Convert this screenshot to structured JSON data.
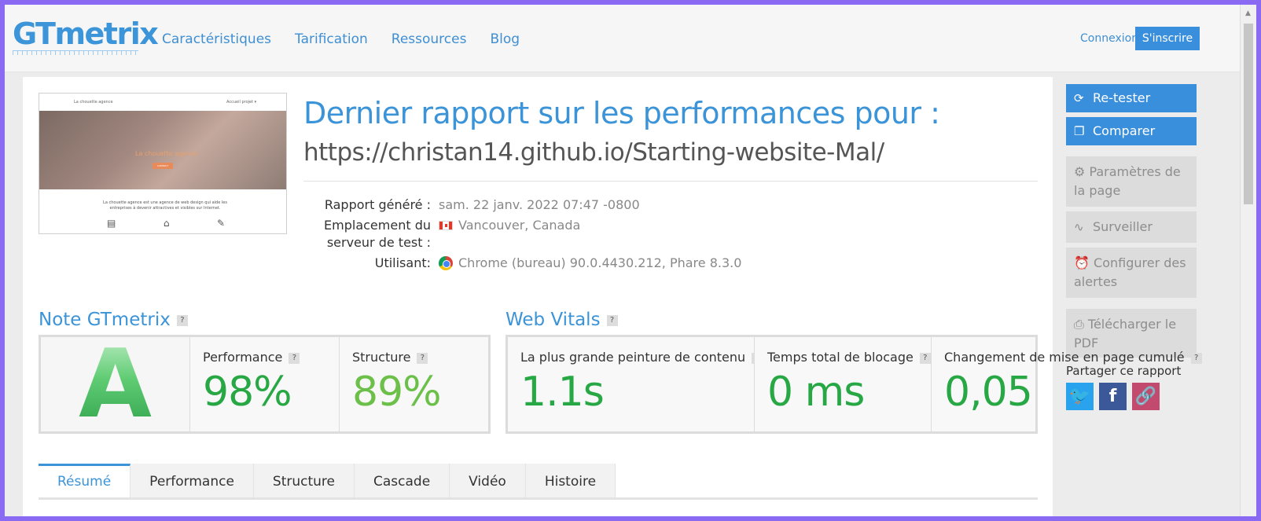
{
  "header": {
    "logo": "GTmetrix",
    "nav": [
      "Caractéristiques",
      "Tarification",
      "Ressources",
      "Blog"
    ],
    "login": "Connexion",
    "signup": "S'inscrire"
  },
  "report": {
    "title": "Dernier rapport sur les performances pour :",
    "url": "https://christan14.github.io/Starting-website-Mal/",
    "meta": [
      {
        "label": "Rapport généré :",
        "value": "sam. 22 janv. 2022 07:47 -0800"
      },
      {
        "label": "Emplacement du serveur de test :",
        "value": "Vancouver, Canada"
      },
      {
        "label": "Utilisant:",
        "value": "Chrome (bureau) 90.0.4430.212, Phare 8.3.0"
      }
    ]
  },
  "thumbnail": {
    "site_name": "La chouette agence",
    "nav_right": "Accueil  projet ▾",
    "hero_text": "La chouette agence",
    "hero_button": "CONTACT",
    "body_text": "La chouette agence est une agence de web design qui aide les entreprises à devenir attractives et visibles sur Internet."
  },
  "grade": {
    "section_title": "Note GTmetrix",
    "help": "?",
    "letter": "A",
    "performance_label": "Performance",
    "performance_value": "98%",
    "structure_label": "Structure",
    "structure_value": "89%"
  },
  "vitals": {
    "section_title": "Web Vitals",
    "help": "?",
    "lcp_label": "La plus grande peinture de contenu",
    "lcp_value": "1.1s",
    "tbt_label": "Temps total de blocage",
    "tbt_value": "0 ms",
    "cls_label": "Changement de mise en page cumulé",
    "cls_value": "0,05"
  },
  "tabs": [
    "Résumé",
    "Performance",
    "Structure",
    "Cascade",
    "Vidéo",
    "Histoire"
  ],
  "active_tab": "Résumé",
  "sidebar": {
    "retest": "Re-tester",
    "compare": "Comparer",
    "page_settings": "Paramètres de la page",
    "monitor": "Surveiller",
    "alerts": "Configurer des alertes",
    "download_pdf": "Télécharger le PDF",
    "share_title": "Partager ce rapport"
  },
  "colors": {
    "brand_blue": "#3a8fdc",
    "grade_green": "#3cb35a",
    "value_green": "#28a745"
  }
}
